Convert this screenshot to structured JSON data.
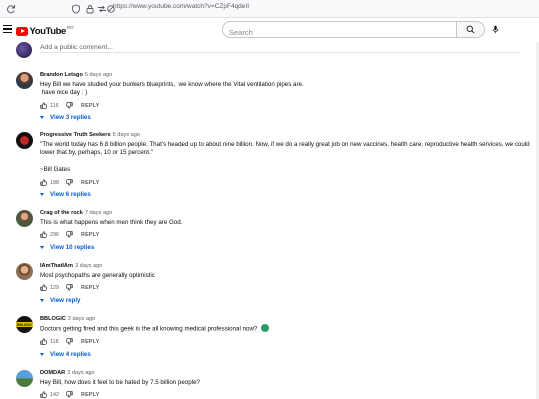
{
  "browser": {
    "url": "https://www.youtube.com/watch?v=CZpF4qdeII"
  },
  "header": {
    "logo_text": "YouTube",
    "region": "RO",
    "search_placeholder": "Search"
  },
  "add_comment": {
    "placeholder": "Add a public comment..."
  },
  "comments": [
    {
      "author": "Brandon Letsgo",
      "time": "5 days ago",
      "text": "Hey Bill we have studied your bunkers blueprints,  we know where the Vital ventilation pipes are.\n have nice day : )",
      "likes": "116",
      "reply_label": "REPLY",
      "replies_label": "View 3 replies"
    },
    {
      "author": "Progressive Truth Seekers",
      "time": "5 days ago",
      "text": "\"The world today has 6.8 billion people. That's headed up to about nine billion. Now, if we do a really great job on new vaccines, health care, reproductive health services, we could lower that by, perhaps, 10 or 15 percent.\"\n\n~Bill Gates",
      "likes": "188",
      "reply_label": "REPLY",
      "replies_label": "View 6 replies"
    },
    {
      "author": "Crag of the rock",
      "time": "7 days ago",
      "text": "This is what happens when men think they are God.",
      "likes": "296",
      "reply_label": "REPLY",
      "replies_label": "View 10 replies"
    },
    {
      "author": "IAmThatIAm",
      "time": "3 days ago",
      "text": "Most psychopaths are generally optimistic",
      "likes": "129",
      "reply_label": "REPLY",
      "replies_label": "View reply"
    },
    {
      "author": "BBLOGIC",
      "time": "3 days ago",
      "avatar_text": "BBLOGIC",
      "text": "Doctors getting fired and this geek is the all knowing medical professional now?",
      "likes": "118",
      "reply_label": "REPLY",
      "replies_label": "View 4 replies"
    },
    {
      "author": "DOMDAR",
      "time": "3 days ago",
      "text": "Hey Bill, how does it feel to be hated by 7.5 billion people?",
      "likes": "142",
      "reply_label": "REPLY"
    }
  ],
  "icons": {
    "like": "thumb-up-icon",
    "dislike": "thumb-down-icon",
    "search": "search-icon",
    "mic": "mic-icon",
    "emoji": "face-emoji-icon"
  },
  "colors": {
    "link_blue": "#065fd4",
    "brand_red": "#ff0000"
  }
}
